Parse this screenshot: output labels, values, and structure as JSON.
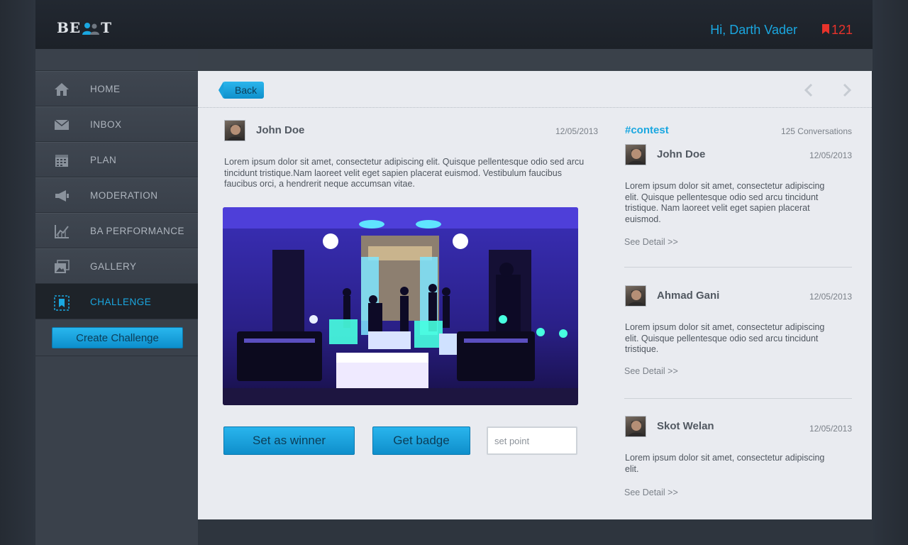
{
  "header": {
    "logo_left": "BE",
    "logo_right": "T",
    "greeting": "Hi, Darth Vader",
    "notification_count": "121"
  },
  "sidebar": {
    "items": [
      {
        "label": "HOME",
        "icon": "home-icon"
      },
      {
        "label": "INBOX",
        "icon": "mail-icon"
      },
      {
        "label": "PLAN",
        "icon": "calendar-icon"
      },
      {
        "label": "MODERATION",
        "icon": "megaphone-icon"
      },
      {
        "label": "BA PERFORMANCE",
        "icon": "chart-icon"
      },
      {
        "label": "GALLERY",
        "icon": "gallery-icon"
      },
      {
        "label": "CHALLENGE",
        "icon": "bookmark-icon",
        "active": true
      }
    ],
    "create_label": "Create Challenge"
  },
  "main": {
    "back_label": "Back",
    "post": {
      "author": "John Doe",
      "date": "12/05/2013",
      "text": "Lorem ipsum dolor sit amet, consectetur adipiscing elit. Quisque pellentesque odio sed arcu tincidunt tristique.Nam laoreet velit eget sapien placerat euismod. Vestibulum faucibus faucibus orci, a hendrerit neque accumsan vitae."
    },
    "winner_label": "Set as winner",
    "badge_label": "Get badge",
    "point_placeholder": "set point"
  },
  "conversations": {
    "tag": "#contest",
    "count_label": "125 Conversations",
    "items": [
      {
        "name": "John Doe",
        "date": "12/05/2013",
        "text": "Lorem ipsum dolor sit amet, consectetur adipiscing elit. Quisque pellentesque odio sed arcu tincidunt tristique. Nam laoreet velit eget sapien placerat euismod.",
        "link": "See Detail >>"
      },
      {
        "name": "Ahmad Gani",
        "date": "12/05/2013",
        "text": "Lorem ipsum dolor sit amet, consectetur adipiscing elit. Quisque pellentesque odio sed arcu tincidunt tristique.",
        "link": "See Detail >>"
      },
      {
        "name": "Skot Welan",
        "date": "12/05/2013",
        "text": "Lorem ipsum dolor sit amet, consectetur adipiscing elit.",
        "link": "See Detail >>"
      }
    ]
  },
  "colors": {
    "accent": "#1aa7e0",
    "notification": "#e8332b",
    "sidebar": "#3a414b",
    "panel": "#e9ebf0"
  }
}
